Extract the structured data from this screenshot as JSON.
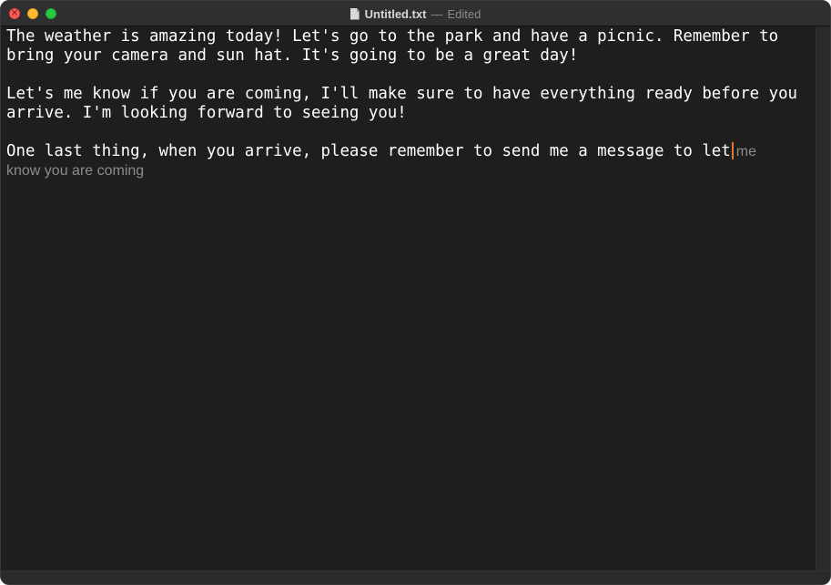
{
  "window": {
    "title": "Untitled.txt",
    "separator": "—",
    "status": "Edited"
  },
  "editor": {
    "paragraph_1": "The weather is amazing today! Let's go to the park and have a picnic. Remember to bring your camera and sun hat. It's going to be a great day!",
    "paragraph_2": "Let's me know if you are coming, I'll make sure to have everything ready before you arrive. I'm looking forward to seeing you!",
    "paragraph_3": "One last thing, when you arrive, please remember to send me a message to let",
    "suggestion_inline": "me",
    "suggestion_continued": "know you are coming"
  },
  "colors": {
    "background": "#1e1e1e",
    "titlebar": "#2f2f31",
    "text": "#ffffff",
    "suggestion": "#8c8c8c",
    "caret": "#e07a2e"
  },
  "icons": {
    "close": "close-icon",
    "minimize": "minimize-icon",
    "zoom": "zoom-icon",
    "document": "document-icon"
  }
}
